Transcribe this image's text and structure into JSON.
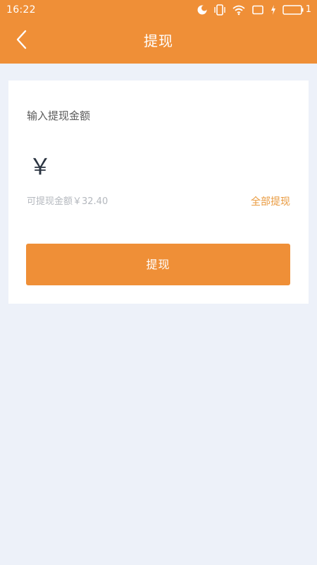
{
  "status_bar": {
    "time": "16:22",
    "battery_level": "1",
    "icons": [
      "moon-icon",
      "vibrate-icon",
      "wifi-icon",
      "screen-icon",
      "charging-icon",
      "battery-icon"
    ]
  },
  "nav": {
    "title": "提现",
    "back_icon": "chevron-left-icon"
  },
  "form": {
    "amount_label": "输入提现金额",
    "currency_symbol": "￥",
    "amount_value": "",
    "available_text": "可提现金额￥32.40",
    "withdraw_all_label": "全部提现",
    "submit_label": "提现"
  },
  "colors": {
    "accent": "#ef8f37",
    "background": "#edf1f9",
    "link": "#e99a3f"
  }
}
